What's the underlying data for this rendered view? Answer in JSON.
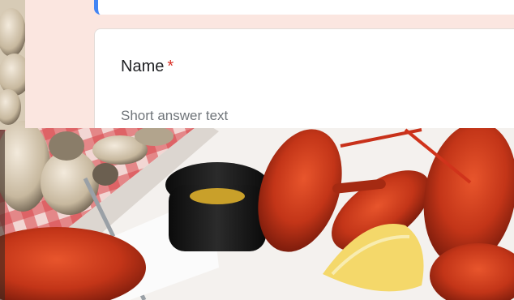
{
  "form": {
    "question_label": "Name",
    "required_marker": "*",
    "answer_placeholder": "Short answer text"
  },
  "colors": {
    "accent": "#4285f4",
    "panel_background": "#fbe6e0",
    "required": "#d93025"
  }
}
